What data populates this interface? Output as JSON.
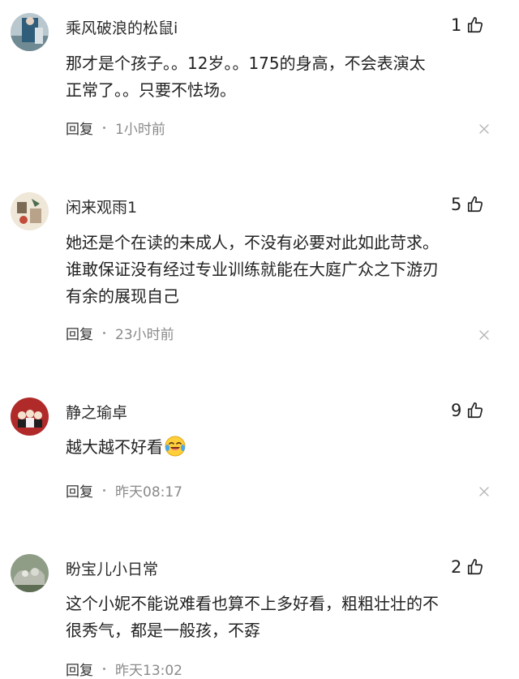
{
  "comments": [
    {
      "username": "乘风破浪的松鼠i",
      "likes": "1",
      "text_lines": [
        "那才是个孩子。。12岁。。175的身高，不会表演太",
        "正常了。。只要不怯场。"
      ],
      "reply_label": "回复",
      "time": "1小时前"
    },
    {
      "username": "闲来观雨1",
      "likes": "5",
      "text_lines": [
        "她还是个在读的未成人，不没有必要对此如此苛求。",
        "谁敢保证没有经过专业训练就能在大庭广众之下游刃",
        "有余的展现自己"
      ],
      "reply_label": "回复",
      "time": "23小时前"
    },
    {
      "username": "静之瑜卓",
      "likes": "9",
      "text_lines": [
        "越大越不好看"
      ],
      "emoji": "laughing-crying-emoji",
      "reply_label": "回复",
      "time": "昨天08:17"
    },
    {
      "username": "盼宝儿小日常",
      "likes": "2",
      "text_lines": [
        "这个小妮不能说难看也算不上多好看，粗粗壮壮的不",
        "很秀气，都是一般孩，不孬"
      ],
      "reply_label": "回复",
      "time": "昨天13:02"
    }
  ],
  "icons": {
    "like": "thumbs-up-icon",
    "close": "close-icon"
  },
  "colors": {
    "text": "#222222",
    "meta": "#8a8a8a",
    "background": "#ffffff"
  }
}
